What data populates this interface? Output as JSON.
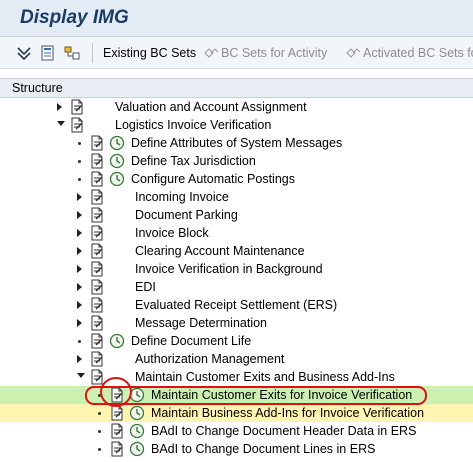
{
  "window": {
    "title": "Display IMG"
  },
  "toolbar": {
    "existing_bc_sets": "Existing BC Sets",
    "bc_sets_for_activity": "BC Sets for Activity",
    "activated_bc_sets": "Activated BC Sets fo"
  },
  "structure": {
    "header": "Structure"
  },
  "tree": {
    "items": [
      {
        "label": "Valuation and Account Assignment",
        "state": "collapsed",
        "clock": false
      },
      {
        "label": "Logistics Invoice Verification",
        "state": "expanded",
        "clock": false
      },
      {
        "label": "Define Attributes of System Messages",
        "state": "leaf",
        "clock": true
      },
      {
        "label": "Define Tax Jurisdiction",
        "state": "leaf",
        "clock": true
      },
      {
        "label": "Configure Automatic Postings",
        "state": "leaf",
        "clock": true
      },
      {
        "label": "Incoming Invoice",
        "state": "collapsed",
        "clock": false
      },
      {
        "label": "Document Parking",
        "state": "collapsed",
        "clock": false
      },
      {
        "label": "Invoice Block",
        "state": "collapsed",
        "clock": false
      },
      {
        "label": "Clearing Account Maintenance",
        "state": "collapsed",
        "clock": false
      },
      {
        "label": "Invoice Verification in Background",
        "state": "collapsed",
        "clock": false
      },
      {
        "label": "EDI",
        "state": "collapsed",
        "clock": false
      },
      {
        "label": "Evaluated Receipt Settlement (ERS)",
        "state": "collapsed",
        "clock": false
      },
      {
        "label": "Message Determination",
        "state": "collapsed",
        "clock": false
      },
      {
        "label": "Define Document Life",
        "state": "leaf",
        "clock": true
      },
      {
        "label": "Authorization Management",
        "state": "collapsed",
        "clock": false
      },
      {
        "label": "Maintain Customer Exits and Business Add-Ins",
        "state": "expanded",
        "clock": false
      },
      {
        "label": "Maintain Customer Exits for Invoice Verification",
        "state": "leaf",
        "clock": true
      },
      {
        "label": "Maintain Business Add-Ins for Invoice Verification",
        "state": "leaf",
        "clock": true
      },
      {
        "label": "BAdI to Change Document Header Data in ERS",
        "state": "leaf",
        "clock": true
      },
      {
        "label": "BAdI to Change Document Lines in ERS",
        "state": "leaf",
        "clock": true
      }
    ]
  },
  "colors": {
    "selected_row": "#ccf0b0",
    "highlighted_row": "#fff4b0",
    "annotation": "#e01010",
    "title": "#1a3c66"
  }
}
